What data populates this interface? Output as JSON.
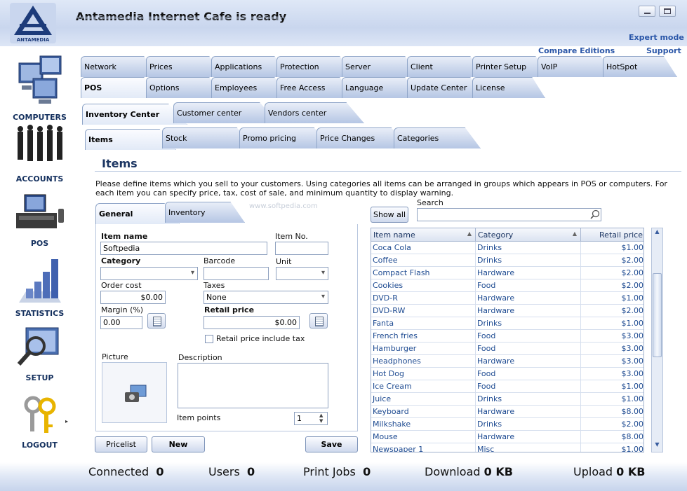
{
  "app": {
    "title": "Antamedia Internet Cafe is ready",
    "logo_text": "ANTAMEDIA"
  },
  "top_links": {
    "expert_mode": "Expert mode",
    "compare_editions": "Compare Editions",
    "support": "Support"
  },
  "sidebar": [
    {
      "label": "COMPUTERS",
      "icon": "computers-icon"
    },
    {
      "label": "ACCOUNTS",
      "icon": "accounts-icon"
    },
    {
      "label": "POS",
      "icon": "pos-icon"
    },
    {
      "label": "STATISTICS",
      "icon": "statistics-icon"
    },
    {
      "label": "SETUP",
      "icon": "setup-icon"
    },
    {
      "label": "LOGOUT",
      "icon": "logout-icon"
    }
  ],
  "main_tabs_row1": [
    "Network",
    "Prices",
    "Applications",
    "Protection",
    "Server",
    "Client",
    "Printer Setup",
    "VoIP",
    "HotSpot"
  ],
  "main_tabs_row2": [
    "POS",
    "Options",
    "Employees",
    "Free Access",
    "Language",
    "Update Center",
    "License"
  ],
  "pos_tabs": [
    "Inventory Center",
    "Customer center",
    "Vendors center"
  ],
  "inventory_tabs": [
    "Items",
    "Stock",
    "Promo pricing",
    "Price Changes",
    "Categories"
  ],
  "items": {
    "heading": "Items",
    "description": "Please define items which you sell to your customers. Using categories all items can be arranged in groups which appears in POS or computers. For each item you can specify price, tax, cost of sale, and minimum quantity to display warning.",
    "subtabs": [
      "General",
      "Inventory"
    ],
    "watermark": "www.softpedia.com"
  },
  "form": {
    "item_name_label": "Item name",
    "item_name_value": "Softpedia",
    "item_no_label": "Item No.",
    "item_no_value": "",
    "category_label": "Category",
    "category_value": "",
    "barcode_label": "Barcode",
    "barcode_value": "",
    "unit_label": "Unit",
    "unit_value": "",
    "order_cost_label": "Order cost",
    "order_cost_value": "$0.00",
    "taxes_label": "Taxes",
    "taxes_value": "None",
    "margin_label": "Margin (%)",
    "margin_value": "0.00",
    "retail_price_label": "Retail price",
    "retail_price_value": "$0.00",
    "retail_include_tax_label": "Retail price include tax",
    "picture_label": "Picture",
    "description_label": "Description",
    "item_points_label": "Item points",
    "item_points_value": "1"
  },
  "buttons": {
    "pricelist": "Pricelist",
    "new": "New",
    "save": "Save",
    "show_all": "Show all"
  },
  "search": {
    "label": "Search",
    "value": ""
  },
  "table": {
    "columns": [
      "Item name",
      "Category",
      "Retail price"
    ],
    "rows": [
      [
        "Coca Cola",
        "Drinks",
        "$1.00"
      ],
      [
        "Coffee",
        "Drinks",
        "$2.00"
      ],
      [
        "Compact Flash",
        "Hardware",
        "$2.00"
      ],
      [
        "Cookies",
        "Food",
        "$2.00"
      ],
      [
        "DVD-R",
        "Hardware",
        "$1.00"
      ],
      [
        "DVD-RW",
        "Hardware",
        "$2.00"
      ],
      [
        "Fanta",
        "Drinks",
        "$1.00"
      ],
      [
        "French fries",
        "Food",
        "$3.00"
      ],
      [
        "Hamburger",
        "Food",
        "$3.00"
      ],
      [
        "Headphones",
        "Hardware",
        "$3.00"
      ],
      [
        "Hot Dog",
        "Food",
        "$3.00"
      ],
      [
        "Ice Cream",
        "Food",
        "$1.00"
      ],
      [
        "Juice",
        "Drinks",
        "$1.00"
      ],
      [
        "Keyboard",
        "Hardware",
        "$8.00"
      ],
      [
        "Milkshake",
        "Drinks",
        "$2.00"
      ],
      [
        "Mouse",
        "Hardware",
        "$8.00"
      ],
      [
        "Newspaper 1",
        "Misc",
        "$1.00"
      ]
    ]
  },
  "status": {
    "connected_label": "Connected",
    "connected_value": "0",
    "users_label": "Users",
    "users_value": "0",
    "print_jobs_label": "Print Jobs",
    "print_jobs_value": "0",
    "download_label": "Download",
    "download_value": "0 KB",
    "upload_label": "Upload",
    "upload_value": "0 KB"
  }
}
